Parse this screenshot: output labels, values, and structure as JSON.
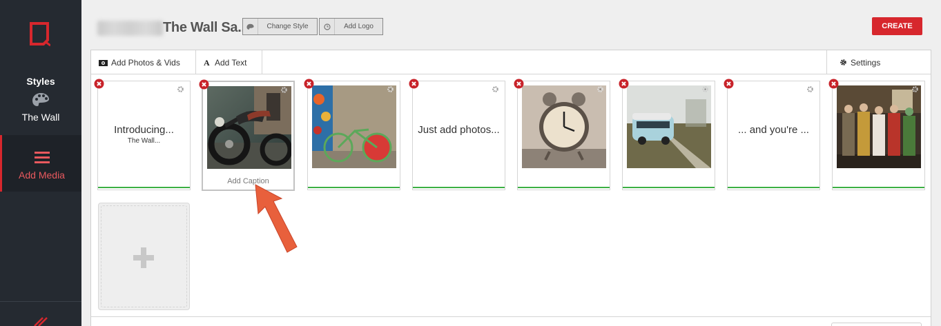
{
  "sidebar": {
    "logo_icon": "brand-logo-icon",
    "styles_label": "Styles",
    "theme_name": "The Wall",
    "add_media_label": "Add Media",
    "accent": "#d7272d"
  },
  "header": {
    "title": "The Wall Sa...",
    "change_style_label": "Change Style",
    "add_logo_label": "Add Logo",
    "create_label": "CREATE"
  },
  "toolbar": {
    "add_photos_label": "Add Photos & Vids",
    "add_text_label": "Add Text",
    "settings_label": "Settings"
  },
  "cards": [
    {
      "type": "text",
      "title": "Introducing...",
      "subtitle": "The Wall..."
    },
    {
      "type": "image",
      "image": "motorcycle-photo",
      "caption": "Add Caption",
      "selected": true
    },
    {
      "type": "image",
      "image": "bicycle-photo"
    },
    {
      "type": "text",
      "title": "Just add photos..."
    },
    {
      "type": "image",
      "image": "alarm-clock-photo"
    },
    {
      "type": "image",
      "image": "vw-van-photo"
    },
    {
      "type": "text",
      "title": "... and you're ..."
    },
    {
      "type": "image",
      "image": "band-photo"
    }
  ],
  "colors": {
    "sidebar_bg": "#252a31",
    "create_button": "#d7272d",
    "status_line": "#3cb043",
    "arrow": "#e8603c"
  }
}
